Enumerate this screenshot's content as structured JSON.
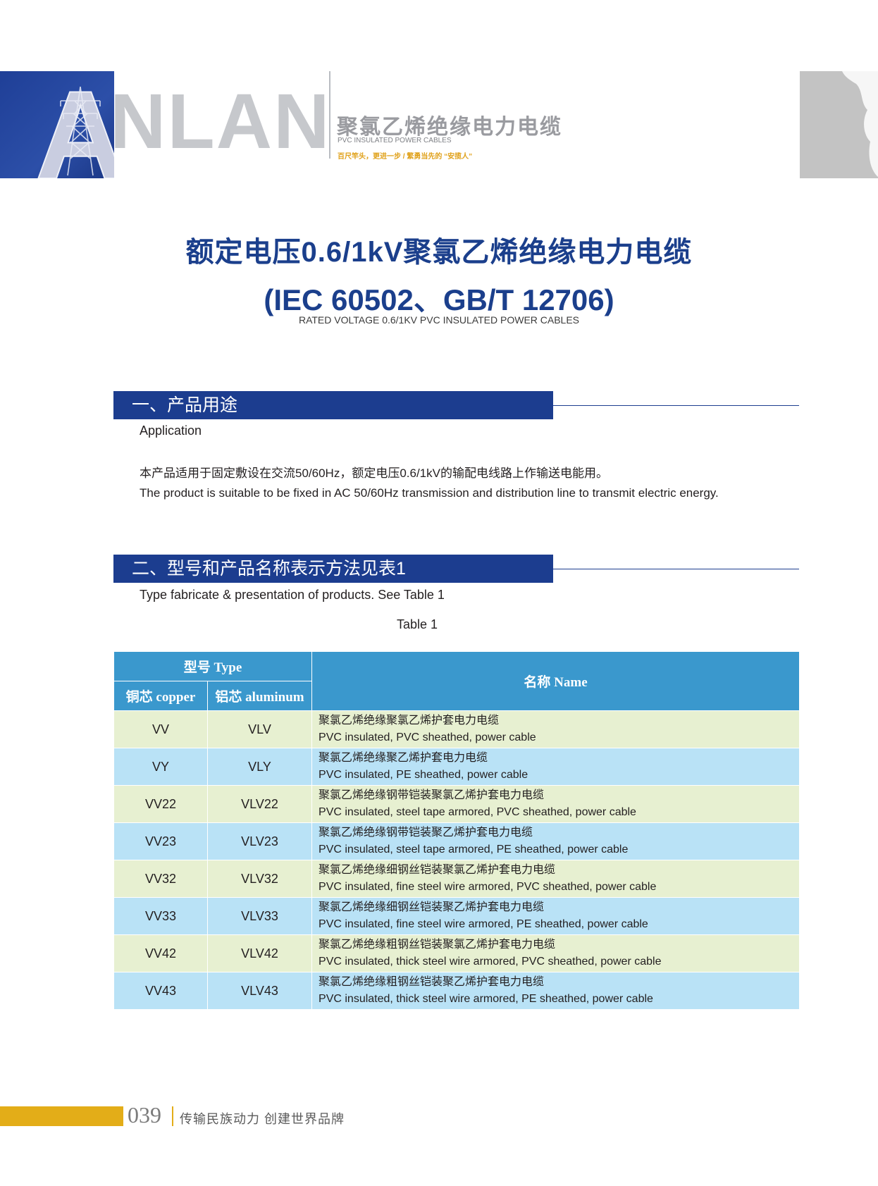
{
  "header": {
    "logo_first": "A",
    "logo_rest": "NLAN",
    "title_cn": "聚氯乙烯绝缘电力电缆",
    "title_en": "PVC INSULATED POWER CABLES",
    "slogan": "百尺竿头，更进一步 / 繁勇当先的 “安揽人”",
    "accent_color": "#1c3d8f",
    "slogan_color": "#e0a11a"
  },
  "title": {
    "cn": "额定电压0.6/1kV聚氯乙烯绝缘电力电缆",
    "standard": "(IEC 60502、GB/T 12706)",
    "en": "RATED VOLTAGE 0.6/1KV PVC INSULATED POWER CABLES"
  },
  "section1": {
    "heading": "一、产品用途",
    "subtitle": "Application",
    "text_cn": "本产品适用于固定敷设在交流50/60Hz，额定电压0.6/1kV的输配电线路上作输送电能用。",
    "text_en": "The product is suitable to be fixed in AC 50/60Hz transmission and distribution line to transmit electric energy."
  },
  "section2": {
    "heading": "二、型号和产品名称表示方法见表1",
    "subtitle": "Type fabricate & presentation of products. See Table 1"
  },
  "table": {
    "caption": "Table 1",
    "header_type": "型号  Type",
    "header_copper": "铜芯  copper",
    "header_aluminum": "铝芯 aluminum",
    "header_name": "名称  Name",
    "header_color": "#3a98cd",
    "row_colors": [
      "#e7f0d1",
      "#b9e2f6"
    ],
    "rows": [
      {
        "copper": "VV",
        "aluminum": "VLV",
        "name_cn": "聚氯乙烯绝缘聚氯乙烯护套电力电缆",
        "name_en": "PVC insulated, PVC sheathed, power cable"
      },
      {
        "copper": "VY",
        "aluminum": "VLY",
        "name_cn": "聚氯乙烯绝缘聚乙烯护套电力电缆",
        "name_en": "PVC insulated, PE sheathed, power cable"
      },
      {
        "copper": "VV22",
        "aluminum": "VLV22",
        "name_cn": "聚氯乙烯绝缘钢带铠装聚氯乙烯护套电力电缆",
        "name_en": "PVC insulated, steel tape armored, PVC sheathed, power cable"
      },
      {
        "copper": "VV23",
        "aluminum": "VLV23",
        "name_cn": "聚氯乙烯绝缘钢带铠装聚乙烯护套电力电缆",
        "name_en": "PVC insulated, steel tape armored, PE sheathed, power cable"
      },
      {
        "copper": "VV32",
        "aluminum": "VLV32",
        "name_cn": "聚氯乙烯绝缘细钢丝铠装聚氯乙烯护套电力电缆",
        "name_en": "PVC insulated, fine steel wire armored, PVC sheathed, power cable"
      },
      {
        "copper": "VV33",
        "aluminum": "VLV33",
        "name_cn": "聚氯乙烯绝缘细钢丝铠装聚乙烯护套电力电缆",
        "name_en": "PVC insulated, fine steel wire armored, PE sheathed, power cable"
      },
      {
        "copper": "VV42",
        "aluminum": "VLV42",
        "name_cn": "聚氯乙烯绝缘粗钢丝铠装聚氯乙烯护套电力电缆",
        "name_en": "PVC insulated, thick steel wire armored, PVC sheathed, power cable"
      },
      {
        "copper": "VV43",
        "aluminum": "VLV43",
        "name_cn": "聚氯乙烯绝缘粗钢丝铠装聚乙烯护套电力电缆",
        "name_en": "PVC insulated, thick steel wire armored, PE sheathed, power cable"
      }
    ]
  },
  "footer": {
    "page_number": "039",
    "slogan": "传输民族动力  创建世界品牌",
    "bar_color": "#e3ad18"
  }
}
